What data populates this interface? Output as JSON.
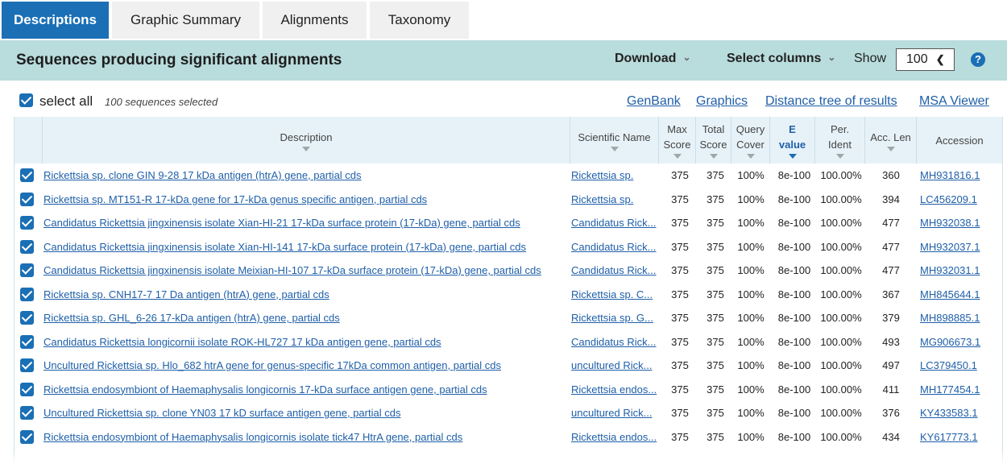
{
  "tabs": [
    {
      "label": "Descriptions",
      "active": true
    },
    {
      "label": "Graphic Summary",
      "active": false
    },
    {
      "label": "Alignments",
      "active": false
    },
    {
      "label": "Taxonomy",
      "active": false
    }
  ],
  "header": {
    "title": "Sequences producing significant alignments",
    "download_label": "Download",
    "select_columns_label": "Select columns",
    "show_label": "Show",
    "show_value": "100"
  },
  "selection": {
    "select_all_label": "select all",
    "selected_text": "100 sequences selected"
  },
  "links": {
    "genbank": "GenBank",
    "graphics": "Graphics",
    "distance_tree": "Distance tree of results",
    "msa_viewer": "MSA Viewer"
  },
  "columns": {
    "description": "Description",
    "scientific_name": "Scientific Name",
    "max_score": "Max Score",
    "total_score": "Total Score",
    "query_cover": "Query Cover",
    "e_value": "E value",
    "per_ident": "Per. Ident",
    "acc_len": "Acc. Len",
    "accession": "Accession"
  },
  "rows": [
    {
      "description": "Rickettsia sp. clone GIN 9-28 17 kDa antigen (htrA) gene, partial cds",
      "scientific_name": "Rickettsia sp.",
      "max_score": "375",
      "total_score": "375",
      "query_cover": "100%",
      "e_value": "8e-100",
      "per_ident": "100.00%",
      "acc_len": "360",
      "accession": "MH931816.1"
    },
    {
      "description": "Rickettsia sp. MT151-R 17-kDa gene for 17-kDa genus specific antigen, partial cds",
      "scientific_name": "Rickettsia sp.",
      "max_score": "375",
      "total_score": "375",
      "query_cover": "100%",
      "e_value": "8e-100",
      "per_ident": "100.00%",
      "acc_len": "394",
      "accession": "LC456209.1"
    },
    {
      "description": "Candidatus Rickettsia jingxinensis isolate Xian-HI-21 17-kDa surface protein (17-kDa) gene, partial cds",
      "scientific_name": "Candidatus Rick...",
      "max_score": "375",
      "total_score": "375",
      "query_cover": "100%",
      "e_value": "8e-100",
      "per_ident": "100.00%",
      "acc_len": "477",
      "accession": "MH932038.1"
    },
    {
      "description": "Candidatus Rickettsia jingxinensis isolate Xian-HI-141 17-kDa surface protein (17-kDa) gene, partial cds",
      "scientific_name": "Candidatus Rick...",
      "max_score": "375",
      "total_score": "375",
      "query_cover": "100%",
      "e_value": "8e-100",
      "per_ident": "100.00%",
      "acc_len": "477",
      "accession": "MH932037.1"
    },
    {
      "description": "Candidatus Rickettsia jingxinensis isolate Meixian-HI-107 17-kDa surface protein (17-kDa) gene, partial cds",
      "scientific_name": "Candidatus Rick...",
      "max_score": "375",
      "total_score": "375",
      "query_cover": "100%",
      "e_value": "8e-100",
      "per_ident": "100.00%",
      "acc_len": "477",
      "accession": "MH932031.1"
    },
    {
      "description": "Rickettsia sp. CNH17-7 17 Da antigen (htrA) gene, partial cds",
      "scientific_name": "Rickettsia sp. C...",
      "max_score": "375",
      "total_score": "375",
      "query_cover": "100%",
      "e_value": "8e-100",
      "per_ident": "100.00%",
      "acc_len": "367",
      "accession": "MH845644.1"
    },
    {
      "description": "Rickettsia sp. GHL_6-26 17-kDa antigen (htrA) gene, partial cds",
      "scientific_name": "Rickettsia sp. G...",
      "max_score": "375",
      "total_score": "375",
      "query_cover": "100%",
      "e_value": "8e-100",
      "per_ident": "100.00%",
      "acc_len": "379",
      "accession": "MH898885.1"
    },
    {
      "description": "Candidatus Rickettsia longicornii isolate ROK-HL727 17 kDa antigen gene, partial cds",
      "scientific_name": "Candidatus Rick...",
      "max_score": "375",
      "total_score": "375",
      "query_cover": "100%",
      "e_value": "8e-100",
      "per_ident": "100.00%",
      "acc_len": "493",
      "accession": "MG906673.1"
    },
    {
      "description": "Uncultured Rickettsia sp. Hlo_682 htrA gene for genus-specific 17kDa common antigen, partial cds",
      "scientific_name": "uncultured Rick...",
      "max_score": "375",
      "total_score": "375",
      "query_cover": "100%",
      "e_value": "8e-100",
      "per_ident": "100.00%",
      "acc_len": "497",
      "accession": "LC379450.1"
    },
    {
      "description": "Rickettsia endosymbiont of Haemaphysalis longicornis 17-kDa surface antigen gene, partial cds",
      "scientific_name": "Rickettsia endos...",
      "max_score": "375",
      "total_score": "375",
      "query_cover": "100%",
      "e_value": "8e-100",
      "per_ident": "100.00%",
      "acc_len": "411",
      "accession": "MH177454.1"
    },
    {
      "description": "Uncultured Rickettsia sp. clone YN03 17 kD surface antigen gene, partial cds",
      "scientific_name": "uncultured Rick...",
      "max_score": "375",
      "total_score": "375",
      "query_cover": "100%",
      "e_value": "8e-100",
      "per_ident": "100.00%",
      "acc_len": "376",
      "accession": "KY433583.1"
    },
    {
      "description": "Rickettsia endosymbiont of Haemaphysalis longicornis isolate tick47 HtrA gene, partial cds",
      "scientific_name": "Rickettsia endos...",
      "max_score": "375",
      "total_score": "375",
      "query_cover": "100%",
      "e_value": "8e-100",
      "per_ident": "100.00%",
      "acc_len": "434",
      "accession": "KY617773.1"
    }
  ]
}
